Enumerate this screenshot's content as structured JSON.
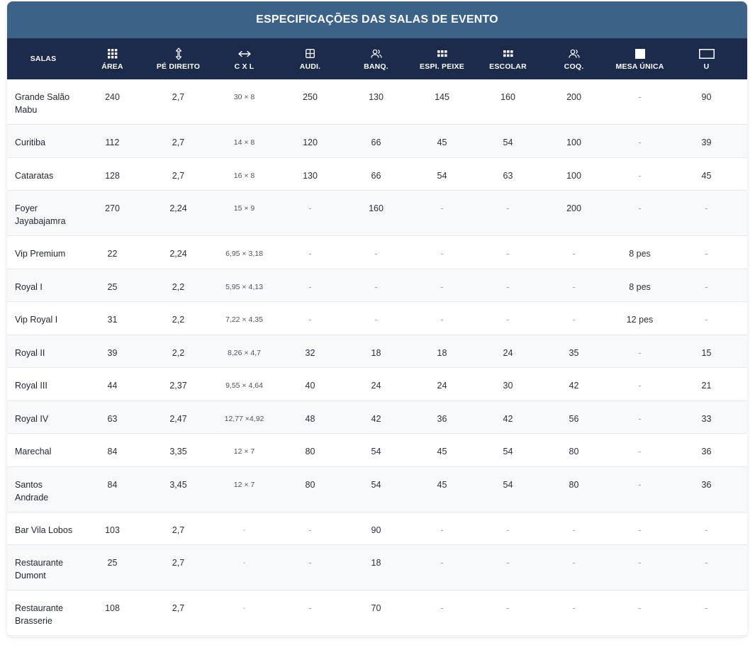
{
  "title": "ESPECIFICAÇÕES DAS SALAS DE EVENTO",
  "columns": [
    {
      "label": "SALAS",
      "icon": "none"
    },
    {
      "label": "ÁREA",
      "icon": "grid-dots-icon"
    },
    {
      "label": "PÉ DIREITO",
      "icon": "vertical-arrows-icon"
    },
    {
      "label": "C X L",
      "icon": "horizontal-arrows-icon"
    },
    {
      "label": "AUDI.",
      "icon": "table-grid-icon"
    },
    {
      "label": "BANQ.",
      "icon": "users-icon"
    },
    {
      "label": "ESPI. PEIXE",
      "icon": "dots-block-icon"
    },
    {
      "label": "ESCOLAR",
      "icon": "dots-block-icon"
    },
    {
      "label": "COQ.",
      "icon": "users-icon"
    },
    {
      "label": "MESA ÚNICA",
      "icon": "filled-square-icon"
    },
    {
      "label": "U",
      "icon": "outline-rectangle-icon"
    }
  ],
  "rows": [
    {
      "name": "Grande Salão Mabu",
      "cells": [
        "240",
        "2,7",
        "30 × 8",
        "250",
        "130",
        "145",
        "160",
        "200",
        "-",
        "90"
      ]
    },
    {
      "name": "Curitiba",
      "cells": [
        "112",
        "2,7",
        "14 × 8",
        "120",
        "66",
        "45",
        "54",
        "100",
        "-",
        "39"
      ]
    },
    {
      "name": "Cataratas",
      "cells": [
        "128",
        "2,7",
        "16 × 8",
        "130",
        "66",
        "54",
        "63",
        "100",
        "-",
        "45"
      ]
    },
    {
      "name": "Foyer Jayabajamra",
      "cells": [
        "270",
        "2,24",
        "15 × 9",
        "-",
        "160",
        "-",
        "-",
        "200",
        "-",
        "-"
      ]
    },
    {
      "name": "Vip Premium",
      "cells": [
        "22",
        "2,24",
        "6,95 × 3,18",
        "-",
        "-",
        "-",
        "-",
        "-",
        "8 pes",
        "-"
      ]
    },
    {
      "name": "Royal I",
      "cells": [
        "25",
        "2,2",
        "5,95 × 4,13",
        "-",
        "-",
        "-",
        "-",
        "-",
        "8 pes",
        "-"
      ]
    },
    {
      "name": "Vip Royal I",
      "cells": [
        "31",
        "2,2",
        "7,22 × 4,35",
        "-",
        "-",
        "-",
        "-",
        "-",
        "12 pes",
        "-"
      ]
    },
    {
      "name": "Royal II",
      "cells": [
        "39",
        "2,2",
        "8,26 × 4,7",
        "32",
        "18",
        "18",
        "24",
        "35",
        "-",
        "15"
      ]
    },
    {
      "name": "Royal III",
      "cells": [
        "44",
        "2,37",
        "9,55 × 4,64",
        "40",
        "24",
        "24",
        "30",
        "42",
        "-",
        "21"
      ]
    },
    {
      "name": "Royal IV",
      "cells": [
        "63",
        "2,47",
        "12,77 ×4,92",
        "48",
        "42",
        "36",
        "42",
        "56",
        "-",
        "33"
      ]
    },
    {
      "name": "Marechal",
      "cells": [
        "84",
        "3,35",
        "12 × 7",
        "80",
        "54",
        "45",
        "54",
        "80",
        "-",
        "36"
      ]
    },
    {
      "name": "Santos Andrade",
      "cells": [
        "84",
        "3,45",
        "12 × 7",
        "80",
        "54",
        "45",
        "54",
        "80",
        "-",
        "36"
      ]
    },
    {
      "name": "Bar Vila Lobos",
      "cells": [
        "103",
        "2,7",
        "-",
        "-",
        "90",
        "-",
        "-",
        "-",
        "-",
        "-"
      ]
    },
    {
      "name": "Restaurante Dumont",
      "cells": [
        "25",
        "2,7",
        "-",
        "-",
        "18",
        "-",
        "-",
        "-",
        "-",
        "-"
      ]
    },
    {
      "name": "Restaurante Brasserie",
      "cells": [
        "108",
        "2,7",
        "-",
        "-",
        "70",
        "-",
        "-",
        "-",
        "-",
        "-"
      ]
    }
  ],
  "colors": {
    "title_bg": "#3d6287",
    "header_bg": "#1c2b4b"
  }
}
